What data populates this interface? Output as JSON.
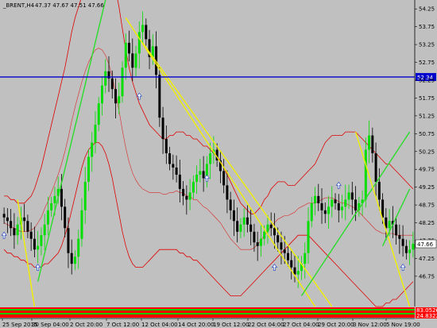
{
  "window": {
    "symbol_label": "_BRENT,H4",
    "ohlc": "47.37 47.67 47.51 47.66"
  },
  "colors": {
    "background": "#c0c0c0",
    "bull": "#00dd00",
    "bear": "#000000",
    "band": "#e00000",
    "trend_up": "#2adc2a",
    "trend_down": "#f0f000",
    "hline": "#0000cc",
    "axis_text": "#000000"
  },
  "chart_data": {
    "type": "candlestick",
    "title": "_BRENT,H4",
    "ylim": [
      45.9,
      54.5
    ],
    "y_ticks": [
      "54.25",
      "53.75",
      "53.25",
      "52.75",
      "52.25",
      "51.75",
      "51.25",
      "50.75",
      "50.25",
      "49.75",
      "49.25",
      "48.75",
      "48.25",
      "47.75",
      "47.25",
      "46.75"
    ],
    "x_ticks": [
      "25 Sep 2015",
      "30 Sep 04:00",
      "2 Oct 20:00",
      "7 Oct 12:00",
      "12 Oct 04:00",
      "14 Oct 20:00",
      "19 Oct 12:00",
      "22 Oct 04:00",
      "27 Oct 04:00",
      "29 Oct 20:00",
      "3 Nov 12:00",
      "5 Nov 19:00"
    ],
    "current_price": "47.66",
    "horizontal_line": {
      "value": 52.34,
      "label": "52.34"
    },
    "indicator_labels": [
      {
        "text": "83.0526",
        "color": "#ff0000"
      },
      {
        "text": "24.8322",
        "color": "#ff0000"
      }
    ],
    "close": [
      48.4,
      48.3,
      48.1,
      47.9,
      48.2,
      48.4,
      48.3,
      48.0,
      47.8,
      47.5,
      47.6,
      47.9,
      48.2,
      48.6,
      48.8,
      49.0,
      49.2,
      48.7,
      48.1,
      47.4,
      47.1,
      47.3,
      47.8,
      48.6,
      49.4,
      50.1,
      50.5,
      51.0,
      51.6,
      52.1,
      52.5,
      52.3,
      52.0,
      51.6,
      51.8,
      52.6,
      53.3,
      53.0,
      52.6,
      53.0,
      53.6,
      53.8,
      53.4,
      52.9,
      53.2,
      52.4,
      51.2,
      50.6,
      50.2,
      49.9,
      49.8,
      49.6,
      49.2,
      49.0,
      48.9,
      49.1,
      49.4,
      49.6,
      49.7,
      49.5,
      49.9,
      50.2,
      50.3,
      50.0,
      49.7,
      49.3,
      48.9,
      48.6,
      48.3,
      48.0,
      48.2,
      48.4,
      48.2,
      48.0,
      47.7,
      47.6,
      47.8,
      48.0,
      48.2,
      48.1,
      47.9,
      47.7,
      47.5,
      47.4,
      47.2,
      47.0,
      46.8,
      46.9,
      47.1,
      47.4,
      48.3,
      48.8,
      49.0,
      48.8,
      48.6,
      48.5,
      48.7,
      48.9,
      48.8,
      48.6,
      48.7,
      48.9,
      49.1,
      48.9,
      48.6,
      48.8,
      48.9,
      50.3,
      50.7,
      50.2,
      49.4,
      48.9,
      48.4,
      48.1,
      48.3,
      48.2,
      47.9,
      47.8,
      47.6,
      47.4,
      47.5,
      47.66
    ],
    "upper_band": [
      49.0,
      49.0,
      48.9,
      48.9,
      48.8,
      48.8,
      48.8,
      48.9,
      49.0,
      49.2,
      49.5,
      49.8,
      50.2,
      50.6,
      51.0,
      51.4,
      51.8,
      52.2,
      52.6,
      53.1,
      53.6,
      54.0,
      54.3,
      54.6,
      54.9,
      55.2,
      55.5,
      55.7,
      55.8,
      55.8,
      55.7,
      55.5,
      55.2,
      54.8,
      54.3,
      53.7,
      53.1,
      52.6,
      52.2,
      51.9,
      51.6,
      51.4,
      51.2,
      51.0,
      50.9,
      50.8,
      50.7,
      50.6,
      50.6,
      50.7,
      50.7,
      50.8,
      50.8,
      50.8,
      50.7,
      50.7,
      50.6,
      50.6,
      50.5,
      50.4,
      50.4,
      50.3,
      50.2,
      50.1,
      50.0,
      49.8,
      49.6,
      49.4,
      49.2,
      49.0,
      48.8,
      48.7,
      48.6,
      48.5,
      48.5,
      48.6,
      48.7,
      48.9,
      49.0,
      49.2,
      49.3,
      49.4,
      49.4,
      49.4,
      49.3,
      49.3,
      49.3,
      49.4,
      49.5,
      49.6,
      49.7,
      49.8,
      49.9,
      50.1,
      50.3,
      50.5,
      50.6,
      50.7,
      50.7,
      50.7,
      50.7,
      50.8,
      50.8,
      50.8,
      50.8,
      50.7,
      50.6,
      50.5,
      50.4,
      50.3,
      50.2,
      50.1,
      50.0,
      49.9,
      49.9,
      49.8,
      49.7,
      49.6,
      49.5,
      49.4,
      49.3,
      49.2
    ],
    "lower_band": [
      47.5,
      47.4,
      47.4,
      47.3,
      47.3,
      47.2,
      47.2,
      47.1,
      47.1,
      47.0,
      47.0,
      47.0,
      47.1,
      47.1,
      47.2,
      47.3,
      47.4,
      47.6,
      47.9,
      48.2,
      48.6,
      49.0,
      49.4,
      49.8,
      50.1,
      50.3,
      50.4,
      50.5,
      50.5,
      50.4,
      50.2,
      49.9,
      49.5,
      49.0,
      48.5,
      48.0,
      47.6,
      47.3,
      47.1,
      47.0,
      47.0,
      47.0,
      47.1,
      47.2,
      47.3,
      47.4,
      47.5,
      47.5,
      47.5,
      47.5,
      47.5,
      47.5,
      47.4,
      47.4,
      47.3,
      47.3,
      47.2,
      47.2,
      47.1,
      47.0,
      46.9,
      46.8,
      46.7,
      46.6,
      46.5,
      46.4,
      46.3,
      46.2,
      46.2,
      46.2,
      46.2,
      46.3,
      46.4,
      46.5,
      46.6,
      46.7,
      46.8,
      46.9,
      47.0,
      47.1,
      47.2,
      47.3,
      47.4,
      47.5,
      47.6,
      47.7,
      47.8,
      47.9,
      47.9,
      47.9,
      47.9,
      47.8,
      47.7,
      47.6,
      47.5,
      47.4,
      47.3,
      47.2,
      47.1,
      47.0,
      46.9,
      46.8,
      46.7,
      46.6,
      46.5,
      46.4,
      46.3,
      46.2,
      46.1,
      46.0,
      45.9,
      45.9,
      45.9,
      46.0,
      46.0,
      46.1,
      46.1,
      46.2,
      46.3,
      46.4,
      46.5,
      46.6
    ],
    "trendlines": [
      {
        "color": "trend_down",
        "from": [
          4,
          48.9
        ],
        "to": [
          9,
          45.9
        ]
      },
      {
        "color": "trend_up",
        "from": [
          10,
          46.6
        ],
        "to": [
          30,
          54.5
        ]
      },
      {
        "color": "trend_down",
        "from": [
          36,
          54.0
        ],
        "to": [
          92,
          45.9
        ]
      },
      {
        "color": "trend_down",
        "from": [
          41,
          53.3
        ],
        "to": [
          97,
          45.9
        ]
      },
      {
        "color": "trend_up",
        "from": [
          88,
          46.2
        ],
        "to": [
          120,
          50.8
        ]
      },
      {
        "color": "trend_down",
        "from": [
          104,
          50.8
        ],
        "to": [
          120,
          45.9
        ]
      },
      {
        "color": "trend_up",
        "from": [
          112,
          47.6
        ],
        "to": [
          120,
          49.2
        ]
      }
    ],
    "arrows": [
      {
        "index": 0,
        "value": 47.9
      },
      {
        "index": 10,
        "value": 47.0
      },
      {
        "index": 40,
        "value": 51.8
      },
      {
        "index": 60,
        "value": 49.5
      },
      {
        "index": 80,
        "value": 47.0
      },
      {
        "index": 99,
        "value": 49.3
      },
      {
        "index": 118,
        "value": 47.0
      }
    ]
  }
}
